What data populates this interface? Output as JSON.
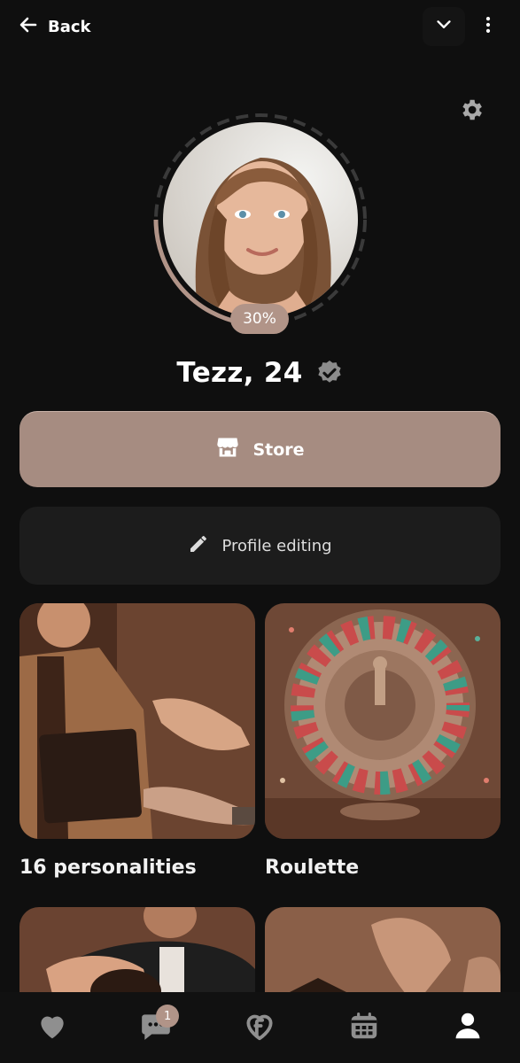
{
  "topbar": {
    "back_label": "Back"
  },
  "profile": {
    "completion": "30%",
    "name_age": "Tezz, 24",
    "verified": true
  },
  "actions": {
    "store_label": "Store",
    "edit_label": "Profile editing"
  },
  "cards": [
    {
      "label": "16 personalities",
      "icon": "personality-image"
    },
    {
      "label": "Roulette",
      "icon": "roulette-image"
    },
    {
      "label": "",
      "icon": "blindfold-image"
    },
    {
      "label": "",
      "icon": "hands-image"
    }
  ],
  "bottom_nav": {
    "items": [
      "heart-icon",
      "chat-icon",
      "brand-icon",
      "calendar-icon",
      "profile-icon"
    ],
    "chat_badge": "1"
  },
  "colors": {
    "accent": "#b19488",
    "background": "#0f0f0f",
    "card_dark": "#1c1c1c",
    "icon_gray": "#8f8f8f"
  }
}
